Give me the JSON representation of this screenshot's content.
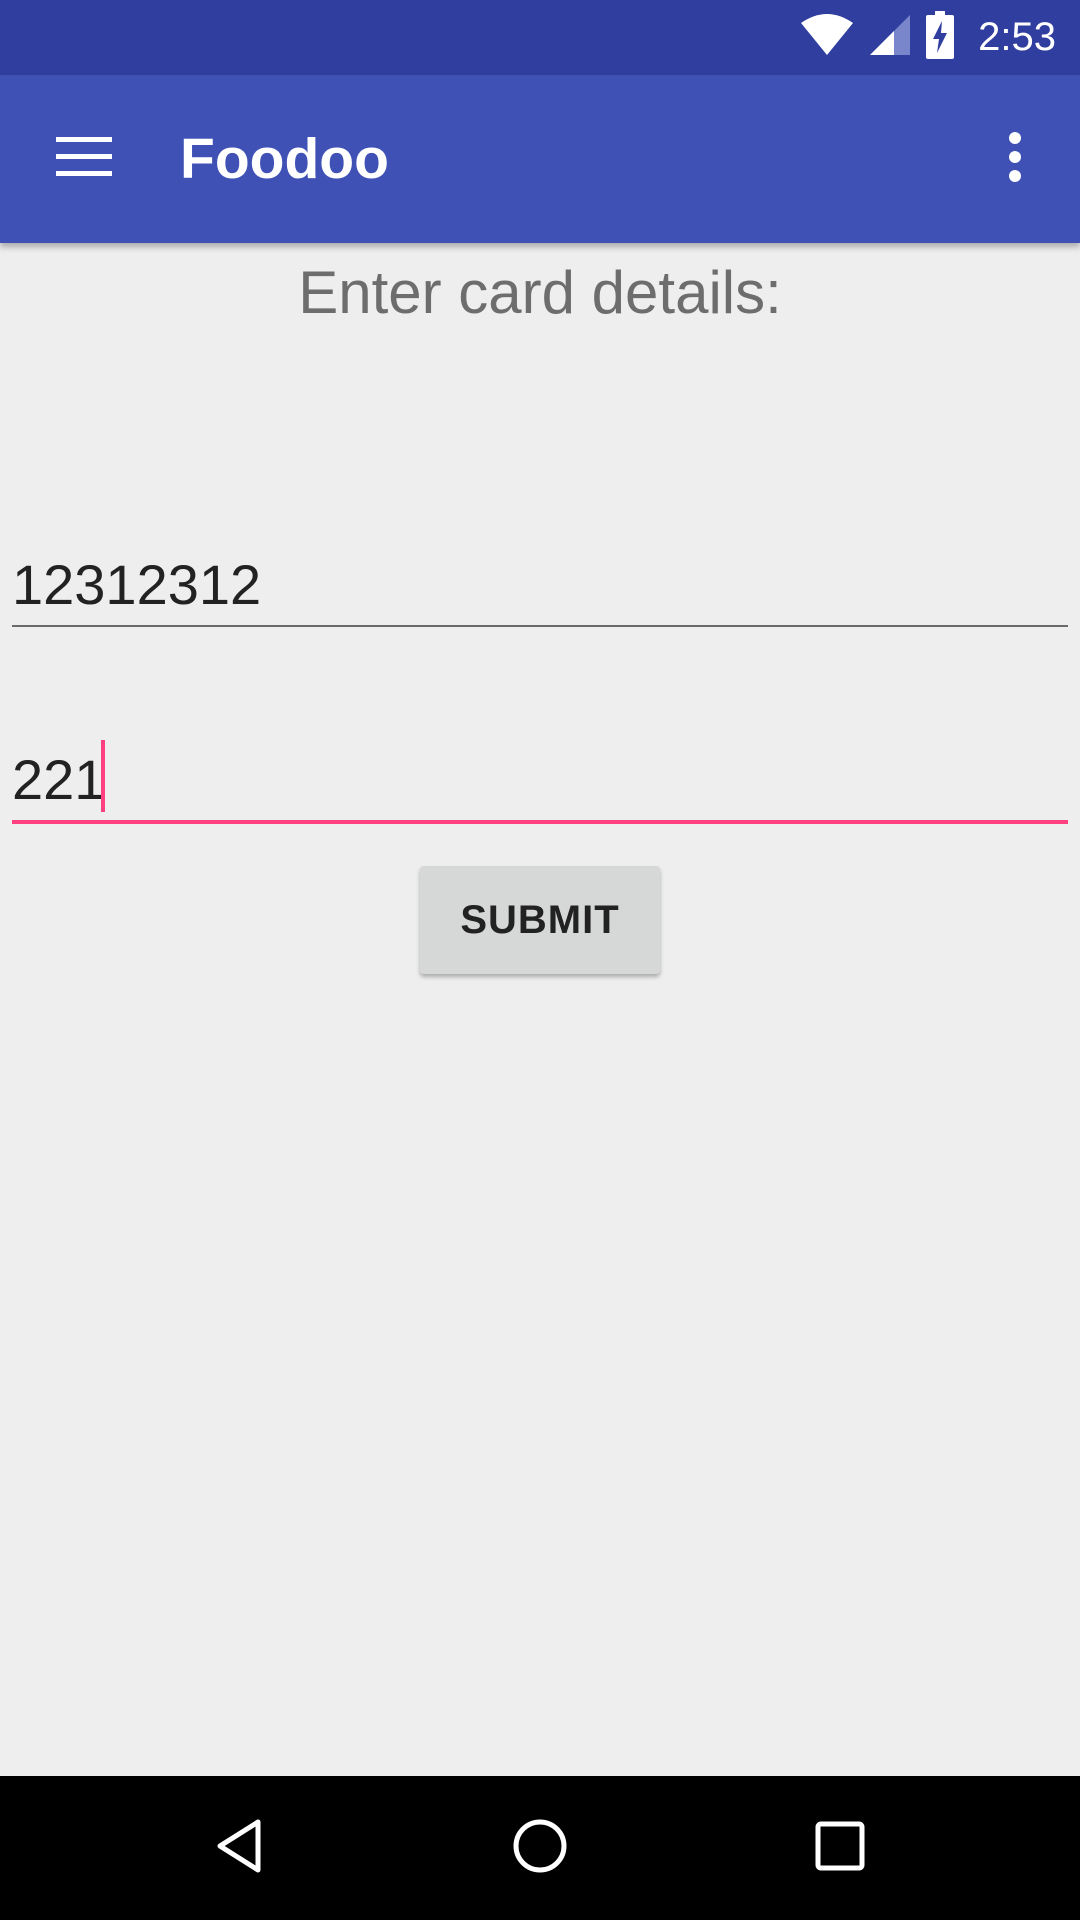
{
  "status_bar": {
    "time": "2:53",
    "icons": [
      "wifi-icon",
      "signal-icon",
      "battery-charging-icon"
    ],
    "color": "#303f9f"
  },
  "app_bar": {
    "title": "Foodoo",
    "color": "#3f51b5",
    "menu_icon": "hamburger-menu-icon",
    "overflow_icon": "more-vertical-icon"
  },
  "content": {
    "prompt": "Enter card details:",
    "card_number_field": {
      "value": "12312312",
      "placeholder": ""
    },
    "cvv_field": {
      "value": "221",
      "placeholder": "",
      "focused": true
    },
    "submit_label": "SUBMIT",
    "accent_color": "#ff4081"
  },
  "nav_bar": {
    "icons": [
      "back-icon",
      "home-icon",
      "recents-icon"
    ]
  }
}
